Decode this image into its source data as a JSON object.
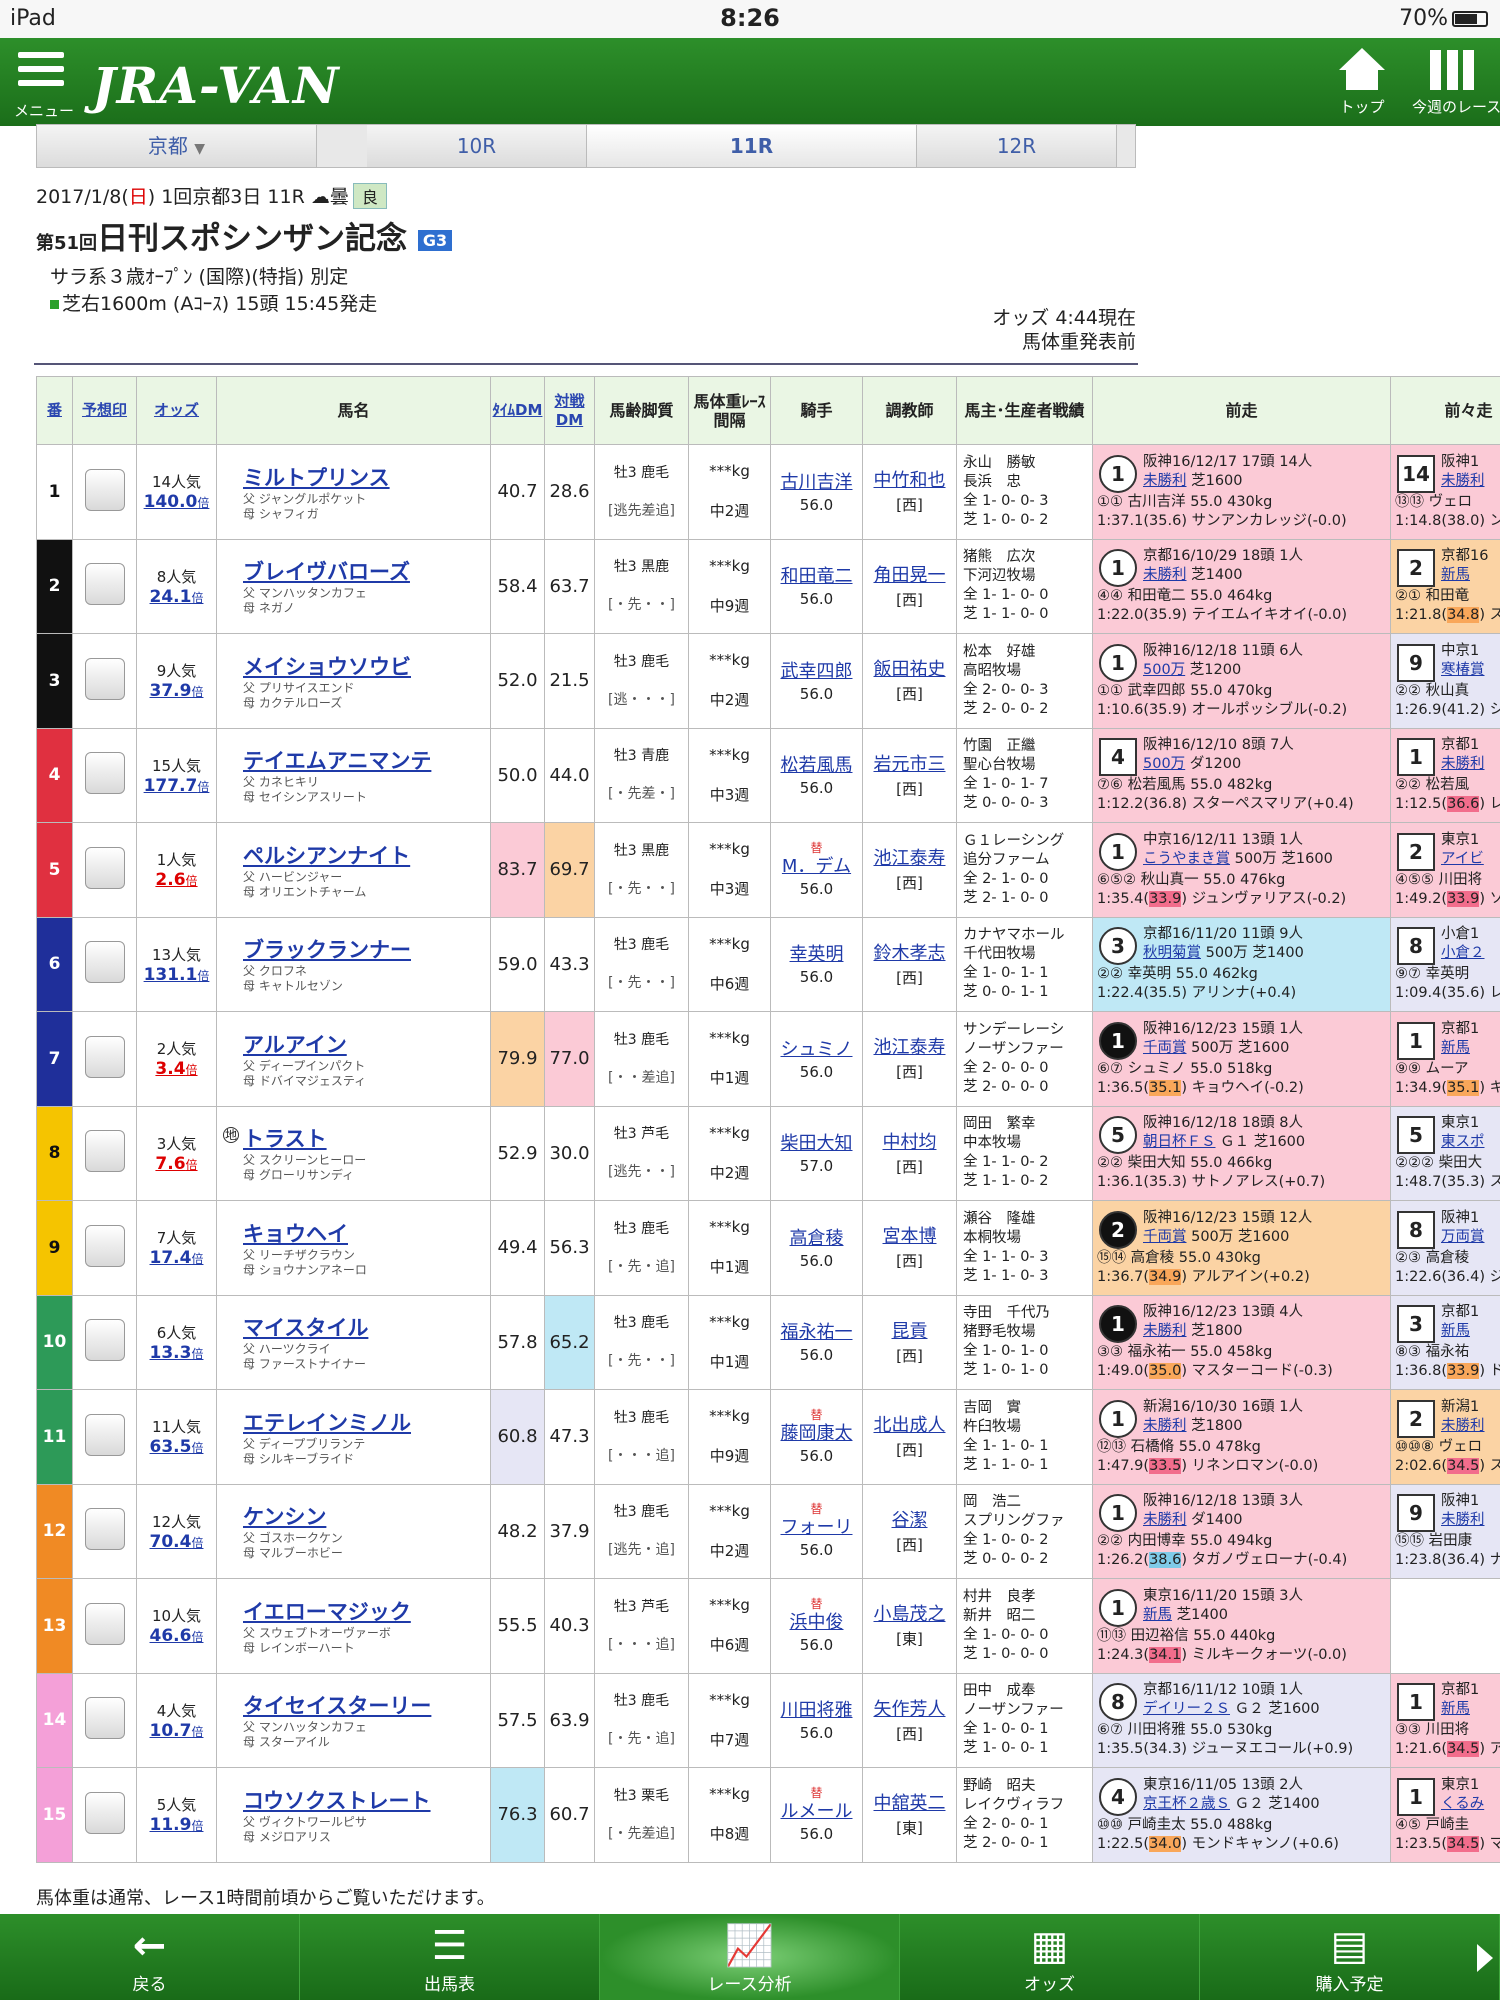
{
  "status": {
    "device": "iPad",
    "time": "8:26",
    "battery": "70%"
  },
  "appbar": {
    "menu": "メニュー",
    "logo": "JRA-VAN",
    "top": "トップ",
    "week": "今週のレース"
  },
  "racenav": {
    "venue": "京都",
    "prev": "10R",
    "cur": "11R",
    "next": "12R"
  },
  "info": {
    "date": "2017/1/8(",
    "dow": "日",
    "date2": ") 1回京都3日 11R",
    "weather": "曇",
    "track": "良",
    "ordinal": "第51回",
    "name": "日刊スポシンザン記念",
    "grade": "G3",
    "cond1": "サラ系３歳ｵｰﾌﾟﾝ (国際)(特指) 別定",
    "cond2": "芝右1600m (Aｺｰｽ) 15頭 15:45発走",
    "odds_time": "オッズ 4:44現在",
    "weight_note": "馬体重発表前"
  },
  "headers": {
    "ban": "番",
    "mark": "予想印",
    "odds": "オッズ",
    "name": "馬名",
    "tdm": "ﾀｲﾑDM",
    "vdm": "対戦DM",
    "age": "馬齢脚質",
    "wt": "馬体重ﾚｰｽ間隔",
    "jockey": "騎手",
    "trainer": "調教師",
    "owner": "馬主･生産者戦績",
    "prev": "前走",
    "prev2": "前々走"
  },
  "colors": [
    "#ffffff",
    "#111111",
    "#e03040",
    "#3a5fb5",
    "#f2c200",
    "#2a9a56",
    "#f08a24",
    "#f4a0d8"
  ],
  "horses": [
    {
      "no": "1",
      "pop": "14人気",
      "odds": "140.0",
      "name": "ミルトプリンス",
      "sire": "父 ジャングルポケット",
      "dam": "母 シャフィガ",
      "tdm": "40.7",
      "vdm": "28.6",
      "age": "牡3 鹿毛",
      "style": "[逃先差追]",
      "wt": "***kg",
      "int": "中2週",
      "jockey": "古川吉洋",
      "jw": "56.0",
      "trainer": "中竹和也",
      "tr": "[西]",
      "owner": "永山　勝敏",
      "breeder": "長浜　忠",
      "rec1": "全 1- 0- 0- 3",
      "rec2": "芝 1- 0- 0- 2",
      "p_pos": "1",
      "p_l1": "阪神16/12/17 17頭 14人",
      "p_cls": "未勝利",
      "p_dist": "芝1600",
      "p_l3a": "①① 古川吉洋 55.0 430kg",
      "p_l4": "1:37.1(35.6) サンアンカレッジ(-0.0)",
      "q_pos": "14",
      "q_l1": "阪神1",
      "q_cls": "未勝利",
      "q_l3": "⑬⑬ ヴェロ",
      "q_l4": "1:14.8(38.0) ン"
    },
    {
      "no": "2",
      "pop": "8人気",
      "odds": "24.1",
      "name": "ブレイヴバローズ",
      "sire": "父 マンハッタンカフェ",
      "dam": "母 ネガノ",
      "tdm": "58.4",
      "vdm": "63.7",
      "age": "牡3 黒鹿",
      "style": "[・先・・]",
      "wt": "***kg",
      "int": "中9週",
      "jockey": "和田竜二",
      "jw": "56.0",
      "trainer": "角田晃一",
      "tr": "[西]",
      "owner": "猪熊　広次",
      "breeder": "下河辺牧場",
      "rec1": "全 1- 1- 0- 0",
      "rec2": "芝 1- 1- 0- 0",
      "p_pos": "1",
      "p_l1": "京都16/10/29 18頭 1人",
      "p_cls": "未勝利",
      "p_dist": "芝1400",
      "p_l3a": "④④ 和田竜二 55.0 464kg",
      "p_l4": "1:22.0(35.9) テイエムイキオイ(-0.0)",
      "q_pos": "2",
      "q_l1": "京都16",
      "q_cls": "新馬",
      "q_l3": "②① 和田竜",
      "q_l4": "1:21.8(34.8) ス"
    },
    {
      "no": "3",
      "pop": "9人気",
      "odds": "37.9",
      "name": "メイショウソウビ",
      "sire": "父 プリサイスエンド",
      "dam": "母 カクテルローズ",
      "tdm": "52.0",
      "vdm": "21.5",
      "age": "牡3 鹿毛",
      "style": "[逃・・・]",
      "wt": "***kg",
      "int": "中2週",
      "jockey": "武幸四郎",
      "jw": "56.0",
      "trainer": "飯田祐史",
      "tr": "[西]",
      "owner": "松本　好雄",
      "breeder": "高昭牧場",
      "rec1": "全 2- 0- 0- 3",
      "rec2": "芝 2- 0- 0- 2",
      "p_pos": "1",
      "p_l1": "阪神16/12/18 11頭 6人",
      "p_cls": "500万",
      "p_dist": "芝1200",
      "p_l3a": "①① 武幸四郎 55.0 470kg",
      "p_l4": "1:10.6(35.9) オールポッシブル(-0.2)",
      "q_pos": "9",
      "q_l1": "中京1",
      "q_cls": "寒椿賞",
      "q_l3": "②② 秋山真",
      "q_l4": "1:26.9(41.2) シ"
    },
    {
      "no": "4",
      "pop": "15人気",
      "odds": "177.7",
      "name": "テイエムアニマンテ",
      "sire": "父 カネヒキリ",
      "dam": "母 セイシンアスリート",
      "tdm": "50.0",
      "vdm": "44.0",
      "age": "牡3 青鹿",
      "style": "[・先差・]",
      "wt": "***kg",
      "int": "中3週",
      "jockey": "松若風馬",
      "jw": "56.0",
      "trainer": "岩元市三",
      "tr": "[西]",
      "owner": "竹園　正繼",
      "breeder": "聖心台牧場",
      "rec1": "全 1- 0- 1- 7",
      "rec2": "芝 0- 0- 0- 3",
      "p_pos": "4",
      "p_l1": "阪神16/12/10 8頭 7人",
      "p_cls": "500万",
      "p_dist": "ダ1200",
      "p_l3a": "⑦⑥ 松若風馬 55.0 482kg",
      "p_l4": "1:12.2(36.8) スターペスマリア(+0.4)",
      "q_pos": "1",
      "q_l1": "京都1",
      "q_cls": "未勝利",
      "q_l3": "②② 松若風",
      "q_l4": "1:12.5(36.6) レ"
    },
    {
      "no": "5",
      "pop": "1人気",
      "odds": "2.6",
      "name": "ペルシアンナイト",
      "sire": "父 ハービンジャー",
      "dam": "母 オリエントチャーム",
      "tdm": "83.7",
      "vdm": "69.7",
      "age": "牡3 黒鹿",
      "style": "[・先・・]",
      "wt": "***kg",
      "int": "中3週",
      "swap": "替",
      "jockey": "M．デム",
      "jw": "56.0",
      "trainer": "池江泰寿",
      "tr": "[西]",
      "owner": "Ｇ１レーシング",
      "breeder": "追分ファーム",
      "rec1": "全 2- 1- 0- 0",
      "rec2": "芝 2- 1- 0- 0",
      "p_pos": "1",
      "p_l1": "中京16/12/11 13頭 1人",
      "p_cls": "こうやまき賞",
      "p_dist": "500万 芝1600",
      "p_l3a": "⑥⑤② 秋山真一 55.0 476kg",
      "p_l4": "1:35.4(33.9) ジュンヴァリアス(-0.2)",
      "q_pos": "2",
      "q_l1": "東京1",
      "q_cls": "アイビ",
      "q_l3": "④⑤⑤ 川田将",
      "q_l4": "1:49.2(33.9) ソ"
    },
    {
      "no": "6",
      "pop": "13人気",
      "odds": "131.1",
      "name": "ブラックランナー",
      "sire": "父 クロフネ",
      "dam": "母 キャトルセゾン",
      "tdm": "59.0",
      "vdm": "43.3",
      "age": "牡3 鹿毛",
      "style": "[・先・・]",
      "wt": "***kg",
      "int": "中6週",
      "jockey": "幸英明",
      "jw": "56.0",
      "trainer": "鈴木孝志",
      "tr": "[西]",
      "owner": "カナヤマホール",
      "breeder": "千代田牧場",
      "rec1": "全 1- 0- 1- 1",
      "rec2": "芝 0- 0- 1- 1",
      "p_pos": "3",
      "p_l1": "京都16/11/20 11頭 9人",
      "p_cls": "秋明菊賞",
      "p_dist": "500万 芝1400",
      "p_l3a": "②② 幸英明 55.0 462kg",
      "p_l4": "1:22.4(35.5) アリンナ(+0.4)",
      "q_pos": "8",
      "q_l1": "小倉1",
      "q_cls": "小倉２",
      "q_l3": "⑨⑦ 幸英明",
      "q_l4": "1:09.4(35.6) レ"
    },
    {
      "no": "7",
      "pop": "2人気",
      "odds": "3.4",
      "name": "アルアイン",
      "sire": "父 ディープインパクト",
      "dam": "母 ドバイマジェスティ",
      "tdm": "79.9",
      "vdm": "77.0",
      "age": "牡3 鹿毛",
      "style": "[・・差追]",
      "wt": "***kg",
      "int": "中1週",
      "jockey": "シュミノ",
      "jw": "56.0",
      "trainer": "池江泰寿",
      "tr": "[西]",
      "owner": "サンデーレーシ",
      "breeder": "ノーザンファー",
      "rec1": "全 2- 0- 0- 0",
      "rec2": "芝 2- 0- 0- 0",
      "p_pos": "1",
      "p_l1": "阪神16/12/23 15頭 1人",
      "p_cls": "千両賞",
      "p_dist": "500万 芝1600",
      "p_l3a": "⑥⑦ シュミノ 55.0 518kg",
      "p_l4": "1:36.5(35.1) キョウヘイ(-0.2)",
      "q_pos": "1",
      "q_l1": "京都1",
      "q_cls": "新馬",
      "q_l3": "⑨⑨ ムーア",
      "q_l4": "1:34.9(35.1) キ"
    },
    {
      "no": "8",
      "pop": "3人気",
      "odds": "7.6",
      "mark": "地",
      "name": "トラスト",
      "sire": "父 スクリーンヒーロー",
      "dam": "母 グローリサンディ",
      "tdm": "52.9",
      "vdm": "30.0",
      "age": "牡3 芦毛",
      "style": "[逃先・・]",
      "wt": "***kg",
      "int": "中2週",
      "jockey": "柴田大知",
      "jw": "57.0",
      "trainer": "中村均",
      "tr": "[西]",
      "owner": "岡田　繁幸",
      "breeder": "中本牧場",
      "rec1": "全 1- 1- 0- 2",
      "rec2": "芝 1- 1- 0- 2",
      "p_pos": "5",
      "p_l1": "阪神16/12/18 18頭 8人",
      "p_cls": "朝日杯ＦＳ",
      "p_dist": "Ｇ１ 芝1600",
      "p_l3a": "②② 柴田大知 55.0 466kg",
      "p_l4": "1:36.1(35.3) サトノアレス(+0.7)",
      "q_pos": "5",
      "q_l1": "東京1",
      "q_cls": "東スポ",
      "q_l3": "②②② 柴田大",
      "q_l4": "1:48.7(35.3) ス"
    },
    {
      "no": "9",
      "pop": "7人気",
      "odds": "17.4",
      "name": "キョウヘイ",
      "sire": "父 リーチザクラウン",
      "dam": "母 ショウナンアネーロ",
      "tdm": "49.4",
      "vdm": "56.3",
      "age": "牡3 鹿毛",
      "style": "[・先・追]",
      "wt": "***kg",
      "int": "中1週",
      "jockey": "高倉稜",
      "jw": "56.0",
      "trainer": "宮本博",
      "tr": "[西]",
      "owner": "瀬谷　隆雄",
      "breeder": "本桐牧場",
      "rec1": "全 1- 1- 0- 3",
      "rec2": "芝 1- 1- 0- 3",
      "p_pos": "2",
      "p_l1": "阪神16/12/23 15頭 12人",
      "p_cls": "千両賞",
      "p_dist": "500万 芝1600",
      "p_l3a": "⑮⑭ 高倉稜 55.0 430kg",
      "p_l4": "1:36.7(34.9) アルアイン(+0.2)",
      "q_pos": "8",
      "q_l1": "阪神1",
      "q_cls": "万両賞",
      "q_l3": "②③ 高倉稜",
      "q_l4": "1:22.6(36.4) ジ"
    },
    {
      "no": "10",
      "pop": "6人気",
      "odds": "13.3",
      "name": "マイスタイル",
      "sire": "父 ハーツクライ",
      "dam": "母 ファーストナイナー",
      "tdm": "57.8",
      "vdm": "65.2",
      "age": "牡3 鹿毛",
      "style": "[・先・・]",
      "wt": "***kg",
      "int": "中1週",
      "jockey": "福永祐一",
      "jw": "56.0",
      "trainer": "昆貢",
      "tr": "[西]",
      "owner": "寺田　千代乃",
      "breeder": "猪野毛牧場",
      "rec1": "全 1- 0- 1- 0",
      "rec2": "芝 1- 0- 1- 0",
      "p_pos": "1",
      "p_l1": "阪神16/12/23 13頭 4人",
      "p_cls": "未勝利",
      "p_dist": "芝1800",
      "p_l3a": "③③ 福永祐一 55.0 458kg",
      "p_l4": "1:49.0(35.0) マスターコード(-0.3)",
      "q_pos": "3",
      "q_l1": "京都1",
      "q_cls": "新馬",
      "q_l3": "⑧③ 福永祐",
      "q_l4": "1:36.8(33.9) ド"
    },
    {
      "no": "11",
      "pop": "11人気",
      "odds": "63.5",
      "name": "エテレインミノル",
      "sire": "父 ディープブリランテ",
      "dam": "母 シルキーブライド",
      "tdm": "60.8",
      "vdm": "47.3",
      "age": "牡3 鹿毛",
      "style": "[・・・追]",
      "wt": "***kg",
      "int": "中9週",
      "swap": "替",
      "jockey": "藤岡康太",
      "jw": "56.0",
      "trainer": "北出成人",
      "tr": "[西]",
      "owner": "吉岡　實",
      "breeder": "杵臼牧場",
      "rec1": "全 1- 1- 0- 1",
      "rec2": "芝 1- 1- 0- 1",
      "p_pos": "1",
      "p_l1": "新潟16/10/30 16頭 1人",
      "p_cls": "未勝利",
      "p_dist": "芝1800",
      "p_l3a": "⑫⑬ 石橋脩 55.0 478kg",
      "p_l4": "1:47.9(33.5) リネンロマン(-0.0)",
      "q_pos": "2",
      "q_l1": "新潟1",
      "q_cls": "未勝利",
      "q_l3": "⑩⑩⑧ ヴェロ",
      "q_l4": "2:02.6(34.5) ス"
    },
    {
      "no": "12",
      "pop": "12人気",
      "odds": "70.4",
      "name": "ケンシン",
      "sire": "父 ゴスホークケン",
      "dam": "母 マルブーホビー",
      "tdm": "48.2",
      "vdm": "37.9",
      "age": "牡3 鹿毛",
      "style": "[逃先・追]",
      "wt": "***kg",
      "int": "中2週",
      "swap": "替",
      "jockey": "フォーリ",
      "jw": "56.0",
      "trainer": "谷潔",
      "tr": "[西]",
      "owner": "岡　浩二",
      "breeder": "スプリングファ",
      "rec1": "全 1- 0- 0- 2",
      "rec2": "芝 0- 0- 0- 2",
      "p_pos": "1",
      "p_l1": "阪神16/12/18 13頭 3人",
      "p_cls": "未勝利",
      "p_dist": "ダ1400",
      "p_l3a": "②② 内田博幸 55.0 494kg",
      "p_l4": "1:26.2(38.6) タガノヴェローナ(-0.4)",
      "q_pos": "9",
      "q_l1": "阪神1",
      "q_cls": "未勝利",
      "q_l3": "⑮⑮ 岩田康",
      "q_l4": "1:23.8(36.4) ナ"
    },
    {
      "no": "13",
      "pop": "10人気",
      "odds": "46.6",
      "name": "イエローマジック",
      "sire": "父 スウェプトオーヴァーボ",
      "dam": "母 レインボーハート",
      "tdm": "55.5",
      "vdm": "40.3",
      "age": "牡3 芦毛",
      "style": "[・・・追]",
      "wt": "***kg",
      "int": "中6週",
      "swap": "替",
      "jockey": "浜中俊",
      "jw": "56.0",
      "trainer": "小島茂之",
      "tr": "[東]",
      "owner": "村井　良孝",
      "breeder": "新井　昭二",
      "rec1": "全 1- 0- 0- 0",
      "rec2": "芝 1- 0- 0- 0",
      "p_pos": "1",
      "p_l1": "東京16/11/20 15頭 3人",
      "p_cls": "新馬",
      "p_dist": "芝1400",
      "p_l3a": "⑪⑬ 田辺裕信 55.0 440kg",
      "p_l4": "1:24.3(34.1) ミルキークォーツ(-0.0)",
      "q_pos": "",
      "q_l1": "",
      "q_cls": "",
      "q_l3": "",
      "q_l4": ""
    },
    {
      "no": "14",
      "pop": "4人気",
      "odds": "10.7",
      "name": "タイセイスターリー",
      "sire": "父 マンハッタンカフェ",
      "dam": "母 スターアイル",
      "tdm": "57.5",
      "vdm": "63.9",
      "age": "牡3 鹿毛",
      "style": "[・先・追]",
      "wt": "***kg",
      "int": "中7週",
      "jockey": "川田将雅",
      "jw": "56.0",
      "trainer": "矢作芳人",
      "tr": "[西]",
      "owner": "田中　成奉",
      "breeder": "ノーザンファー",
      "rec1": "全 1- 0- 0- 1",
      "rec2": "芝 1- 0- 0- 1",
      "p_pos": "8",
      "p_l1": "京都16/11/12 10頭 1人",
      "p_cls": "デイリー２Ｓ",
      "p_dist": "Ｇ２ 芝1600",
      "p_l3a": "⑥⑦ 川田将雅 55.0 530kg",
      "p_l4": "1:35.5(34.3) ジューヌエコール(+0.9)",
      "q_pos": "1",
      "q_l1": "京都1",
      "q_cls": "新馬",
      "q_l3": "③③ 川田将",
      "q_l4": "1:21.6(34.5) ア"
    },
    {
      "no": "15",
      "pop": "5人気",
      "odds": "11.9",
      "name": "コウソクストレート",
      "sire": "父 ヴィクトワールピサ",
      "dam": "母 メジロアリス",
      "tdm": "76.3",
      "vdm": "60.7",
      "age": "牡3 栗毛",
      "style": "[・先差追]",
      "wt": "***kg",
      "int": "中8週",
      "swap": "替",
      "jockey": "ルメール",
      "jw": "56.0",
      "trainer": "中舘英二",
      "tr": "[東]",
      "owner": "野崎　昭夫",
      "breeder": "レイクヴィラフ",
      "rec1": "全 2- 0- 0- 1",
      "rec2": "芝 2- 0- 0- 1",
      "p_pos": "4",
      "p_l1": "東京16/11/05 13頭 2人",
      "p_cls": "京王杯２歳Ｓ",
      "p_dist": "Ｇ２ 芝1400",
      "p_l3a": "⑩⑩ 戸崎圭太 55.0 488kg",
      "p_l4": "1:22.5(34.0) モンドキャンノ(+0.6)",
      "q_pos": "1",
      "q_l1": "東京1",
      "q_cls": "くるみ",
      "q_l3": "④⑤ 戸崎圭",
      "q_l4": "1:23.5(34.5) マ"
    }
  ],
  "note": "馬体重は通常、レース1時間前頃からご覧いただけます。",
  "bottom": {
    "back": "戻る",
    "entries": "出馬表",
    "analysis": "レース分析",
    "odds": "オッズ",
    "plan": "購入予定"
  }
}
